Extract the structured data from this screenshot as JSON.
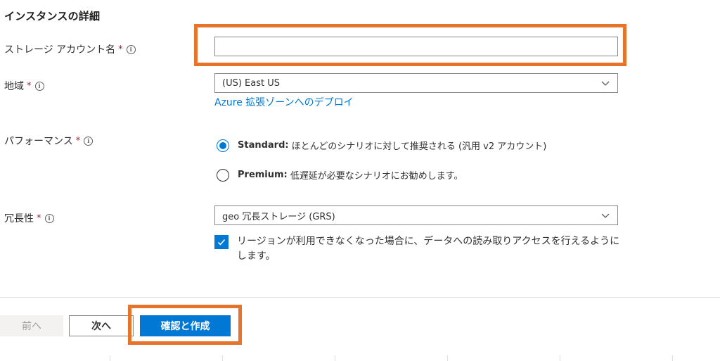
{
  "section": {
    "title": "インスタンスの詳細"
  },
  "fields": {
    "storage_account_name": {
      "label": "ストレージ アカウント名",
      "required_mark": "*",
      "value": ""
    },
    "region": {
      "label": "地域",
      "required_mark": "*",
      "value": "(US) East US",
      "link": "Azure 拡張ゾーンへのデプロイ"
    },
    "performance": {
      "label": "パフォーマンス",
      "required_mark": "*",
      "options": [
        {
          "title": "Standard:",
          "description": "ほとんどのシナリオに対して推奨される (汎用 v2 アカウント)",
          "selected": true
        },
        {
          "title": "Premium:",
          "description": "低遅延が必要なシナリオにお勧めします。",
          "selected": false
        }
      ]
    },
    "redundancy": {
      "label": "冗長性",
      "required_mark": "*",
      "value": "geo 冗長ストレージ (GRS)",
      "checkbox_label": "リージョンが利用できなくなった場合に、データへの読み取りアクセスを行えるようにします。",
      "checkbox_checked": true
    }
  },
  "footer": {
    "prev_label": "前へ",
    "next_label": "次へ",
    "review_label": "確認と作成"
  },
  "colors": {
    "accent": "#0078d4",
    "highlight": "#e8742b",
    "required": "#a4262c"
  },
  "icons": {
    "info": "info-icon",
    "chevron": "chevron-down-icon",
    "check": "checkmark-icon"
  }
}
